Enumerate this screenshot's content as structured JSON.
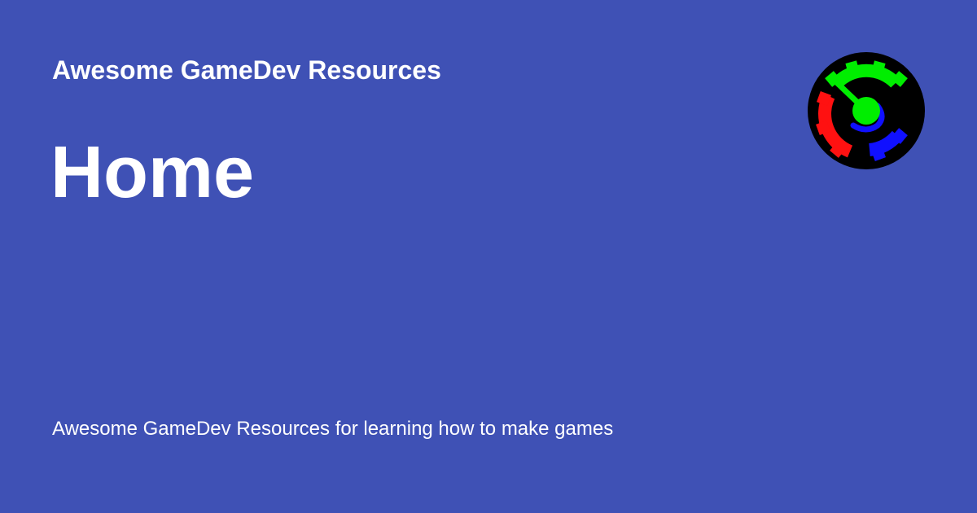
{
  "site": {
    "name": "Awesome GameDev Resources",
    "logo_icon": "gear-gauge-logo-icon"
  },
  "page": {
    "title": "Home",
    "description": "Awesome GameDev Resources for learning how to make games"
  },
  "colors": {
    "background": "#3f51b5",
    "text": "#ffffff",
    "logo_background": "#000000",
    "logo_green": "#00ee00",
    "logo_red": "#ff1111",
    "logo_blue": "#1010ff"
  }
}
